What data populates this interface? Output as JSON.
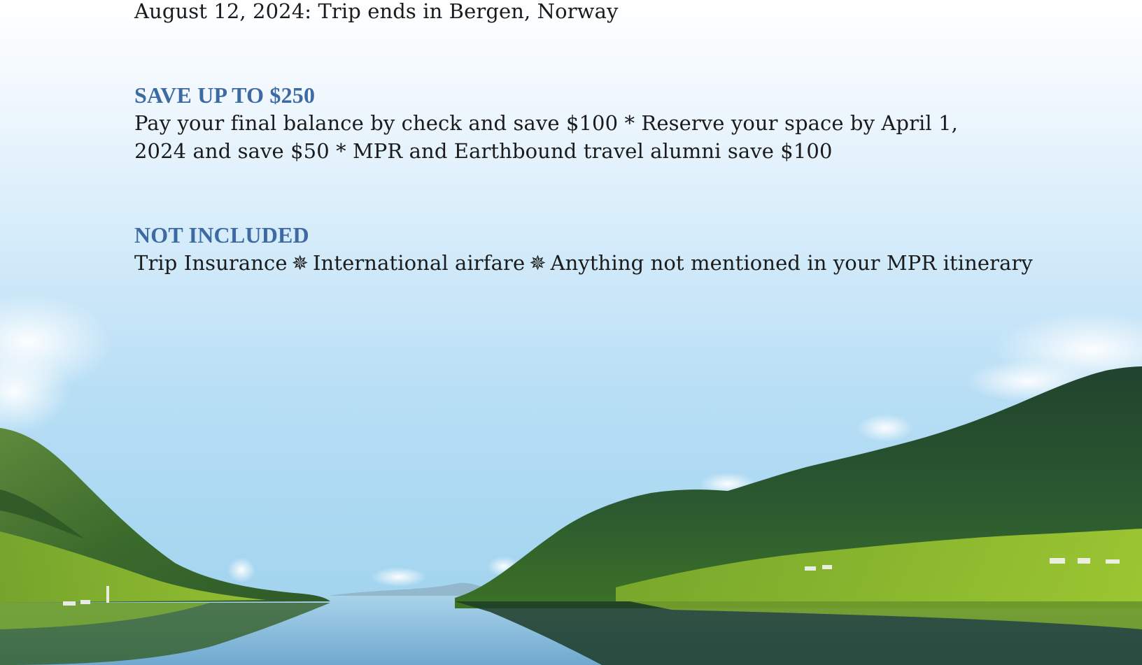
{
  "itinerary": {
    "end_line": "August 12, 2024: Trip ends in Bergen, Norway"
  },
  "save": {
    "heading": "SAVE UP TO $250",
    "body": "Pay your final balance by check and save $100 * Reserve your space by April 1, 2024 and save $50 * MPR and Earthbound travel alumni save $100"
  },
  "not_included": {
    "heading": "NOT INCLUDED",
    "items": [
      "Trip Insurance",
      "International airfare",
      "Anything not mentioned in your MPR itinerary"
    ],
    "separator_icon": "asterisk-star-icon"
  },
  "colors": {
    "heading": "#3d6aa3",
    "body_text": "#1b1b1b",
    "sky_top": "#ffffff",
    "sky_bottom": "#a9d7f0",
    "water": "#7fb6d8",
    "mountain_dark": "#1f3f2a",
    "meadow": "#8fbf2e"
  }
}
